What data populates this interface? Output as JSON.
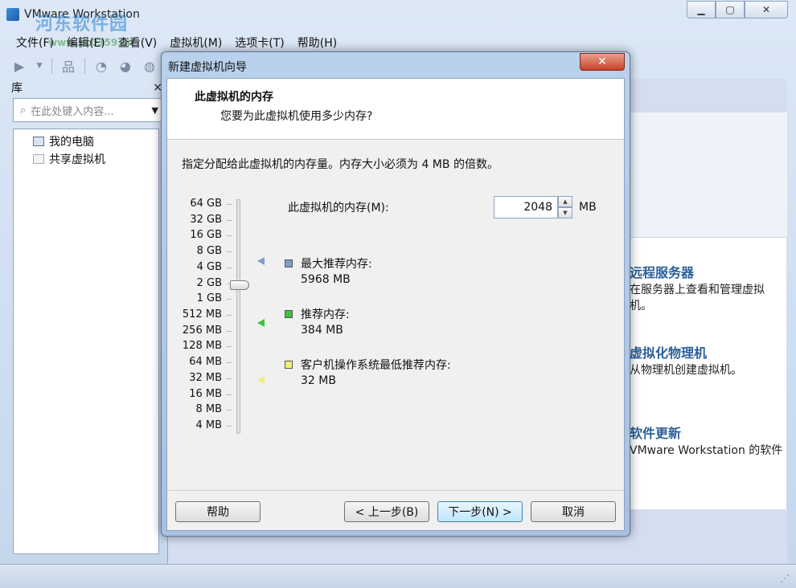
{
  "app": {
    "title": "VMware Workstation",
    "watermark": "河东软件园",
    "watermark_sub": "www.pc0359.cn"
  },
  "menu": [
    "文件(F)",
    "编辑(E)",
    "查看(V)",
    "虚拟机(M)",
    "选项卡(T)",
    "帮助(H)"
  ],
  "sidebar": {
    "title": "库",
    "close": "×",
    "search_placeholder": "在此处键入内容...",
    "tree": [
      {
        "label": "我的电脑"
      },
      {
        "label": "共享虚拟机"
      }
    ]
  },
  "home": {
    "entries": [
      {
        "title": "远程服务器",
        "desc": "在服务器上查看和管理虚拟机。"
      },
      {
        "title": "虚拟化物理机",
        "desc": "从物理机创建虚拟机。"
      },
      {
        "title": "软件更新",
        "desc": "VMware Workstation 的软件"
      }
    ]
  },
  "dialog": {
    "title": "新建虚拟机向导",
    "close": "✕",
    "header_title": "此虚拟机的内存",
    "header_subtitle": "您要为此虚拟机使用多少内存?",
    "instruction": "指定分配给此虚拟机的内存量。内存大小必须为 4 MB 的倍数。",
    "scale": [
      "64 GB",
      "32 GB",
      "16 GB",
      "8 GB",
      "4 GB",
      "2 GB",
      "1 GB",
      "512 MB",
      "256 MB",
      "128 MB",
      "64 MB",
      "32 MB",
      "16 MB",
      "8 MB",
      "4 MB"
    ],
    "memory_label": "此虚拟机的内存(M):",
    "memory_value": "2048",
    "memory_unit": "MB",
    "legend": [
      {
        "label": "最大推荐内存:",
        "value": "5968 MB",
        "color": "#7f9fc9"
      },
      {
        "label": "推荐内存:",
        "value": "384 MB",
        "color": "#3fc23f"
      },
      {
        "label": "客户机操作系统最低推荐内存:",
        "value": "32 MB",
        "color": "#f2f07a"
      }
    ],
    "buttons": {
      "help": "帮助",
      "back": "< 上一步(B)",
      "next": "下一步(N) >",
      "cancel": "取消"
    }
  }
}
